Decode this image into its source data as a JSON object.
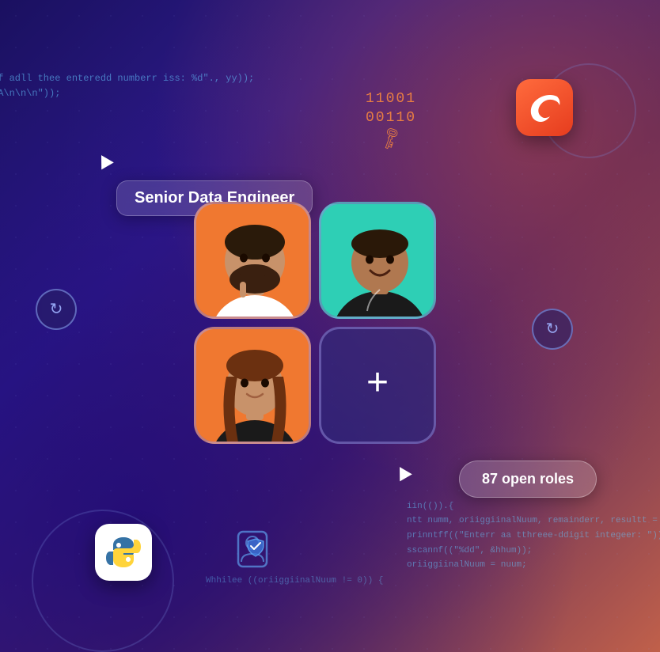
{
  "background": {
    "gradient_start": "#1a1060",
    "gradient_end": "#c0604a"
  },
  "tooltip": {
    "label": "Senior Data Engineer"
  },
  "binary_display": {
    "row1": "11001",
    "row2": "00110"
  },
  "swift_icon": {
    "symbol": "🕊",
    "label": "Swift logo"
  },
  "refresh_icons": [
    {
      "id": "refresh-left",
      "symbol": "↻"
    },
    {
      "id": "refresh-right",
      "symbol": "↻"
    }
  ],
  "photo_grid": {
    "cells": [
      {
        "id": "person-1",
        "type": "photo",
        "bg": "orange",
        "label": "Person 1 - bearded man"
      },
      {
        "id": "person-2",
        "type": "photo",
        "bg": "teal",
        "label": "Person 2 - smiling man"
      },
      {
        "id": "person-3",
        "type": "photo",
        "bg": "orange",
        "label": "Person 3 - woman"
      },
      {
        "id": "add-button",
        "type": "add",
        "label": "Add person",
        "symbol": "+"
      }
    ]
  },
  "roles_badge": {
    "text": "87 open roles"
  },
  "python_icon": {
    "symbol": "🐍",
    "label": "Python"
  },
  "shield_badge": {
    "label": "Verified badge"
  },
  "code_snippets": {
    "top_left": [
      "ff adll thee enteredd numberr iss: %d\"., yy));",
      "!A\\n\\n\\n\"));"
    ],
    "bottom_right": [
      "iin(()).{",
      "ntt numm, oriiggiinalNuum, remainderr, resultt =",
      "prinntff((\"Enterr aa tthreee-ddigit integeer: \"));",
      "sscannf((\"%dd\", &hhum));",
      "oriiggiinalNuum = nuum;"
    ],
    "bottom_left": [
      "",
      "Whhilee ((oriiggiinalNuum != 0)) {"
    ]
  },
  "cursors": [
    {
      "id": "cursor-top",
      "position": "top-left"
    },
    {
      "id": "cursor-bottom",
      "position": "bottom-center"
    }
  ]
}
